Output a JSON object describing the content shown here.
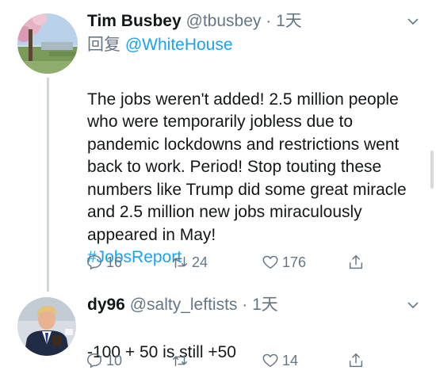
{
  "tweets": [
    {
      "name": "Tim Busbey",
      "handle": "@tbusbey",
      "separator": "·",
      "time": "1天",
      "reply_prefix": "回复",
      "reply_to": "@WhiteHouse",
      "text": "The jobs weren't added! 2.5 million people who were temporarily jobless due to pandemic lockdowns and restrictions went back to work. Period! Stop touting these numbers like Trump did some great miracle and 2.5 million new jobs miraculously appeared in May!",
      "hashtag": "#JobsReport",
      "replies": "16",
      "retweets": "24",
      "likes": "176",
      "avatar_icon": "outdoor-park-avatar"
    },
    {
      "name": "dy96",
      "handle": "@salty_leftists",
      "separator": "·",
      "time": "1天",
      "text": "-100 + 50 is still +50",
      "replies": "10",
      "retweets": "",
      "likes": "14",
      "avatar_icon": "man-in-suit-avatar"
    }
  ],
  "icons": {
    "reply": "reply-icon",
    "retweet": "retweet-icon",
    "like": "heart-icon",
    "share": "share-icon",
    "menu": "chevron-down-icon"
  },
  "colors": {
    "text": "#14171a",
    "secondary": "#657786",
    "link": "#1da1f2",
    "thread_line": "#cfd9de"
  }
}
